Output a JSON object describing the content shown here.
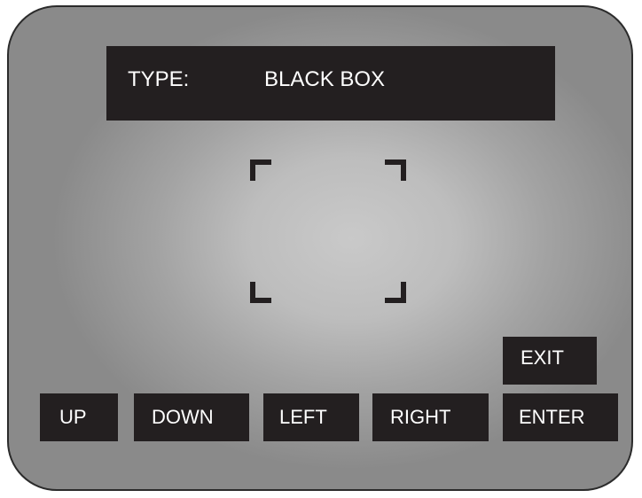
{
  "display": {
    "type_label": "TYPE:",
    "type_value": "BLACK BOX"
  },
  "focus_frame": {
    "icon": "focus-brackets-icon"
  },
  "buttons": {
    "exit": "EXIT",
    "up": "UP",
    "down": "DOWN",
    "left": "LEFT",
    "right": "RIGHT",
    "enter": "ENTER"
  },
  "colors": {
    "panel": "#231f20",
    "text": "#ffffff",
    "screen_center": "#c9c9c9",
    "screen_edge": "#8a8a8a"
  }
}
